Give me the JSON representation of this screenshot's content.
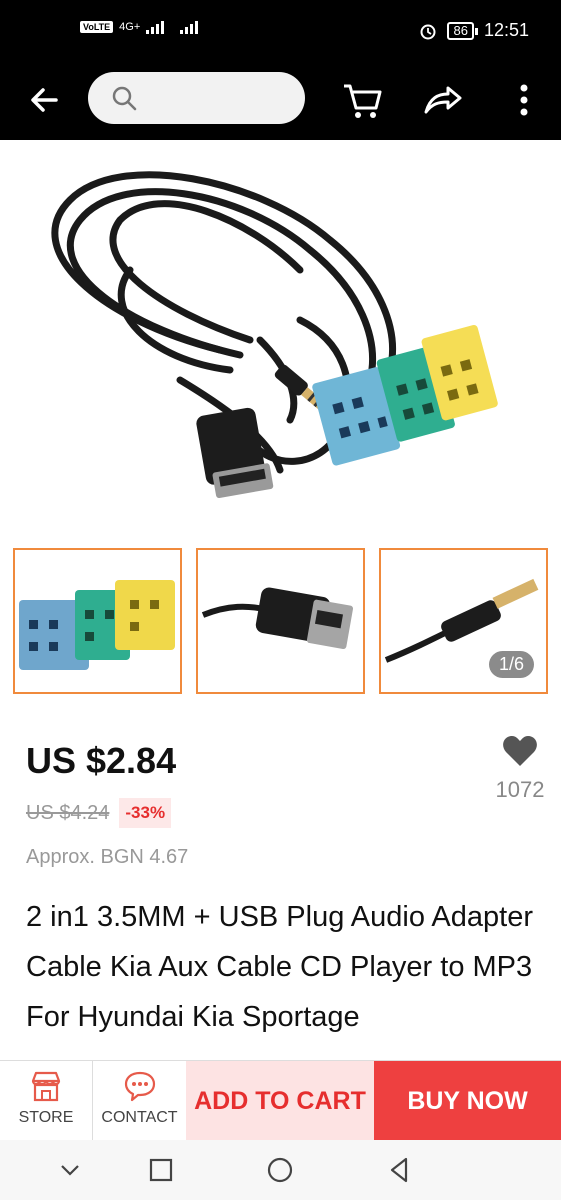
{
  "status_bar": {
    "network": "VoLTE",
    "network_type": "4G+",
    "battery": "86",
    "time": "12:51"
  },
  "search": {
    "placeholder": ""
  },
  "product": {
    "price": "US $2.84",
    "old_price": "US $4.24",
    "discount": "-33%",
    "approx_price": "Approx. BGN 4.67",
    "title": "2 in1 3.5MM + USB Plug Audio Adapter Cable Kia Aux Cable CD Player to MP3 For Hyundai Kia Sportage",
    "wishlist_count": "1072"
  },
  "gallery": {
    "counter": "1/6",
    "current_index": 1,
    "total": 6
  },
  "actions": {
    "store_label": "STORE",
    "contact_label": "CONTACT",
    "add_to_cart_label": "ADD TO CART",
    "buy_now_label": "BUY NOW"
  },
  "icons": {
    "back": "arrow-left-icon",
    "search": "search-icon",
    "cart": "cart-icon",
    "share": "share-icon",
    "more": "more-vertical-icon",
    "wishlist": "heart-icon",
    "store": "store-icon",
    "contact": "chat-icon"
  },
  "colors": {
    "accent_red": "#ee4040",
    "cart_bg": "#fde3e3",
    "thumb_border": "#f08a3c",
    "discount_text": "#e62e2e"
  }
}
